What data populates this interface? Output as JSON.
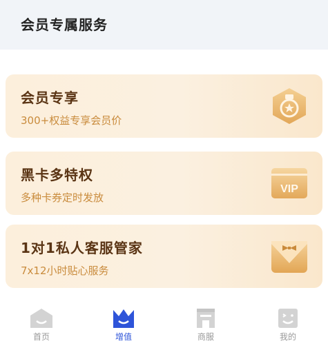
{
  "header": {
    "title": "会员专属服务"
  },
  "cards": [
    {
      "title": "会员专享",
      "subtitle": "300+权益专享会员价",
      "icon": "medal-star-icon"
    },
    {
      "title": "黑卡多特权",
      "subtitle": "多种卡券定时发放",
      "icon": "vip-card-icon"
    },
    {
      "title": "1对1私人客服管家",
      "subtitle": "7x12小时贴心服务",
      "icon": "butler-bowtie-icon"
    }
  ],
  "tabs": [
    {
      "label": "首页",
      "icon": "home-icon",
      "active": false
    },
    {
      "label": "增值",
      "icon": "crown-icon",
      "active": true
    },
    {
      "label": "商服",
      "icon": "building-icon",
      "active": false
    },
    {
      "label": "我的",
      "icon": "smile-face-icon",
      "active": false
    }
  ],
  "colors": {
    "accent": "#2e54d9",
    "card_title": "#5a3414",
    "card_subtitle": "#c98b3c",
    "icon_gold": "#e8b46a"
  }
}
